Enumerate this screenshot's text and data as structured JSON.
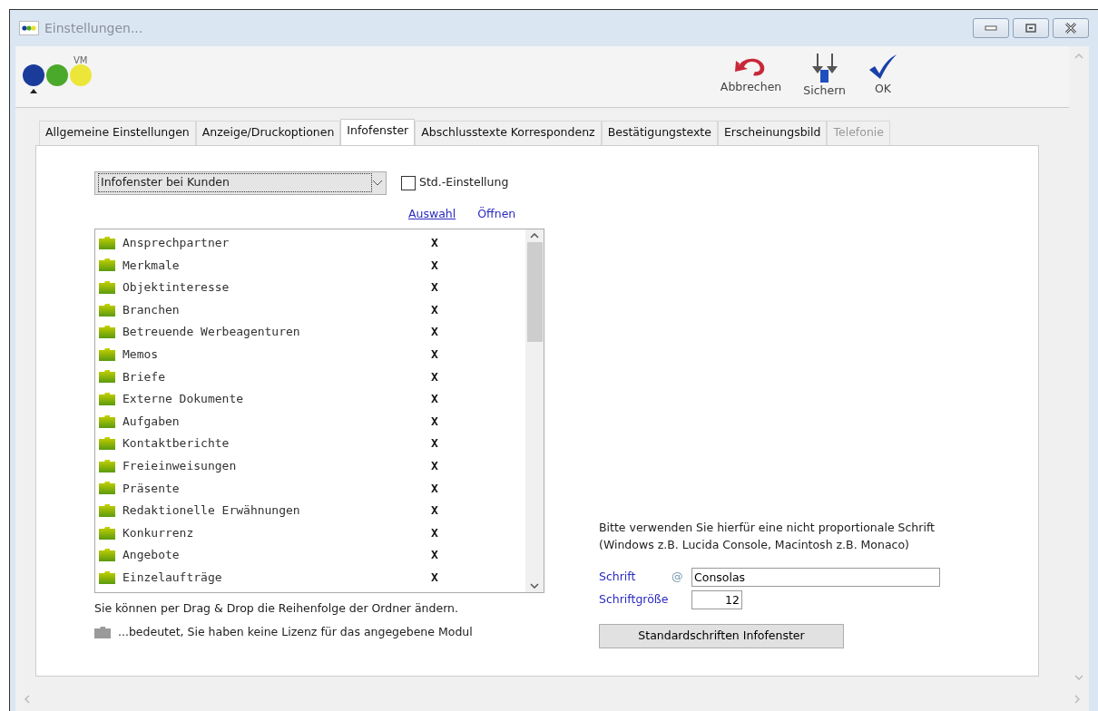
{
  "window": {
    "title": "Einstellungen..."
  },
  "logo": {
    "text": "VM"
  },
  "toolbar": [
    {
      "kind": "cancel",
      "label": "Abbrechen"
    },
    {
      "kind": "save",
      "label": "Sichern"
    },
    {
      "kind": "ok",
      "label": "OK"
    }
  ],
  "tabs": [
    {
      "label": "Allgemeine Einstellungen",
      "selected": false,
      "disabled": false
    },
    {
      "label": "Anzeige/Druckoptionen",
      "selected": false,
      "disabled": false
    },
    {
      "label": "Infofenster",
      "selected": true,
      "disabled": false
    },
    {
      "label": "Abschlusstexte Korrespondenz",
      "selected": false,
      "disabled": false
    },
    {
      "label": "Bestätigungstexte",
      "selected": false,
      "disabled": false
    },
    {
      "label": "Erscheinungsbild",
      "selected": false,
      "disabled": false
    },
    {
      "label": "Telefonie",
      "selected": false,
      "disabled": true
    }
  ],
  "dropdown": {
    "value": "Infofenster bei Kunden"
  },
  "std_checkbox": {
    "label": "Std.-Einstellung",
    "checked": false
  },
  "columns": [
    "Auswahl",
    "Öffnen"
  ],
  "folders": [
    {
      "name": "Ansprechpartner",
      "auswahl": "X"
    },
    {
      "name": "Merkmale",
      "auswahl": "X"
    },
    {
      "name": "Objektinteresse",
      "auswahl": "X"
    },
    {
      "name": "Branchen",
      "auswahl": "X"
    },
    {
      "name": "Betreuende Werbeagenturen",
      "auswahl": "X"
    },
    {
      "name": "Memos",
      "auswahl": "X"
    },
    {
      "name": "Briefe",
      "auswahl": "X"
    },
    {
      "name": "Externe Dokumente",
      "auswahl": "X"
    },
    {
      "name": "Aufgaben",
      "auswahl": "X"
    },
    {
      "name": "Kontaktberichte",
      "auswahl": "X"
    },
    {
      "name": "Freieinweisungen",
      "auswahl": "X"
    },
    {
      "name": "Präsente",
      "auswahl": "X"
    },
    {
      "name": "Redaktionelle Erwähnungen",
      "auswahl": "X"
    },
    {
      "name": "Konkurrenz",
      "auswahl": "X"
    },
    {
      "name": "Angebote",
      "auswahl": "X"
    },
    {
      "name": "Einzelaufträge",
      "auswahl": "X"
    }
  ],
  "hint_drag": "Sie können per Drag & Drop die Reihenfolge der Ordner ändern.",
  "hint_license": "...bedeutet, Sie haben keine Lizenz für das angegebene Modul",
  "font_hint": [
    "Bitte verwenden Sie hierfür eine nicht proportionale Schrift",
    "(Windows z.B. Lucida Console, Macintosh z.B. Monaco)"
  ],
  "font": {
    "label": "Schrift",
    "icon_text": "@",
    "value": "Consolas"
  },
  "font_size": {
    "label": "Schriftgröße",
    "value": "12"
  },
  "default_button": "Standardschriften Infofenster"
}
